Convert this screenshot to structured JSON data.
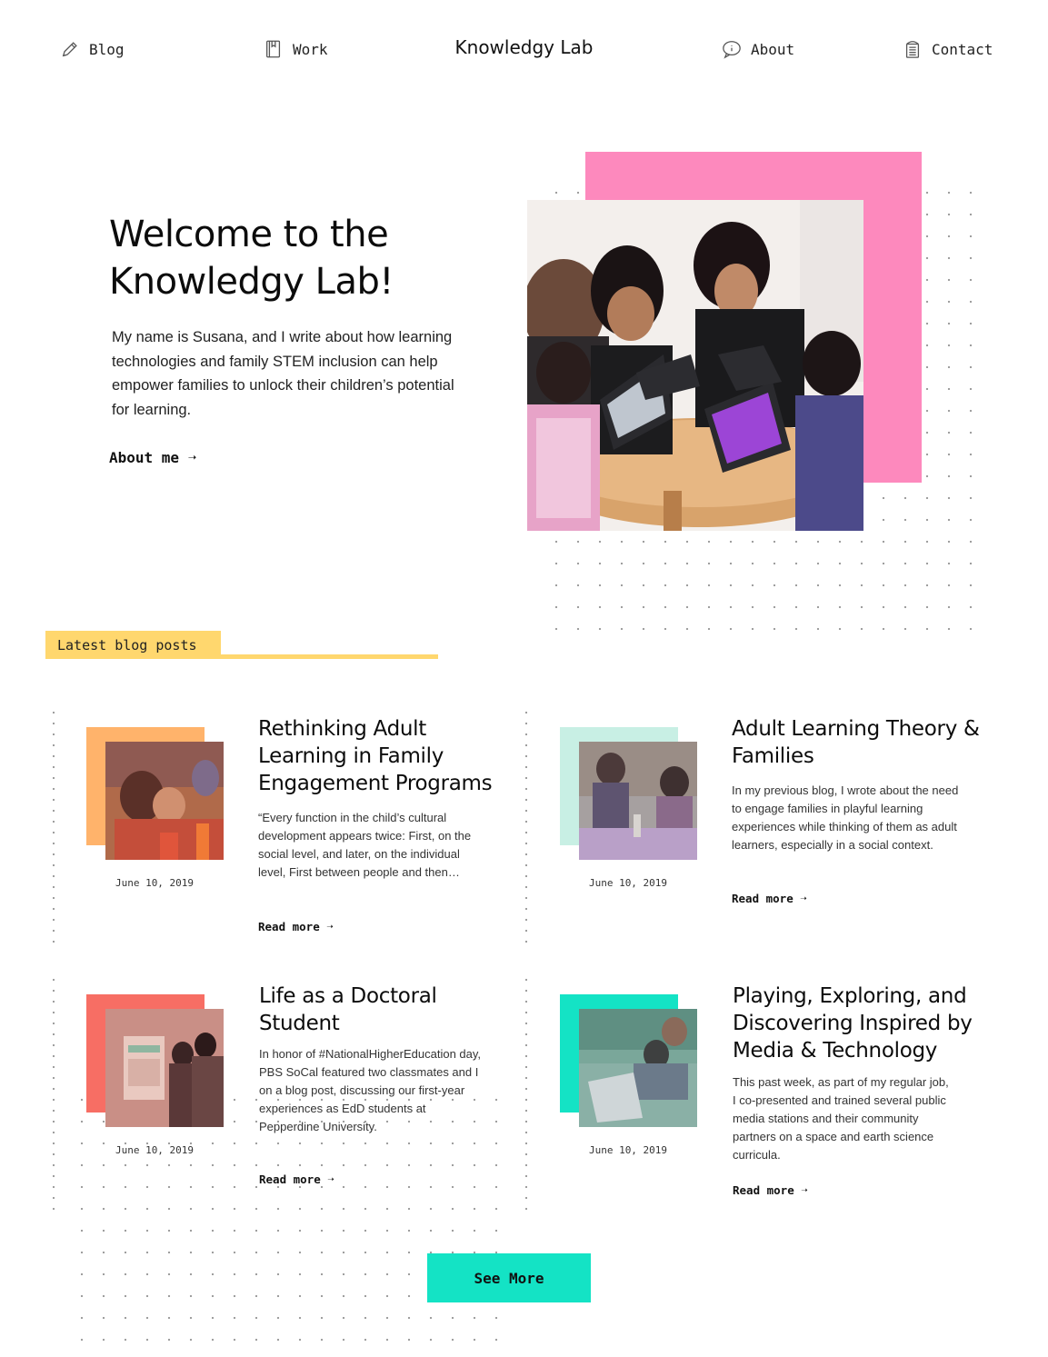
{
  "nav": {
    "blog": "Blog",
    "work": "Work",
    "brand": "Knowledgy Lab",
    "about": "About",
    "contact": "Contact"
  },
  "hero": {
    "title_line1": "Welcome to the",
    "title_line2": "Knowledgy Lab!",
    "text": "My name is Susana, and I write about how learning technologies and family STEM inclusion can help empower families to unlock their children’s potential for learning.",
    "link": "About me ➝",
    "accent_color": "#fd89bd"
  },
  "section": {
    "tag": "Latest blog posts",
    "tag_color": "#ffd76e"
  },
  "posts": [
    {
      "title": "Rethinking Adult Learning in Family Engagement Programs",
      "date": "June 10, 2019",
      "excerpt": "“Every function in the child’s cultural development appears twice: First, on the social level, and later, on the individual level, First between people and then…",
      "link": "Read more ➝",
      "accent": "#ffb36b"
    },
    {
      "title": "Adult Learning Theory & Families",
      "date": "June 10, 2019",
      "excerpt": "In my previous blog, I wrote about the need to engage families in playful learning experiences while thinking of them as adult learners, especially in a social context.",
      "link": "Read more ➝",
      "accent": "#c8efe4"
    },
    {
      "title": "Life as a Doctoral Student",
      "date": "June 10, 2019",
      "excerpt": "In honor of #NationalHigherEducation day, PBS SoCal featured two classmates and I on a blog post, discussing our first-year experiences as EdD students at Pepperdine University.",
      "link": "Read more ➝",
      "accent": "#f76e64"
    },
    {
      "title": "Playing, Exploring, and Discovering Inspired by Media & Technology",
      "date": "June 10, 2019",
      "excerpt": "This past week, as part of my regular job, I co-presented and trained several public media stations and their community partners on a space and earth science curricula.",
      "link": "Read more ➝",
      "accent": "#14e3c5"
    }
  ],
  "see_more": "See More"
}
